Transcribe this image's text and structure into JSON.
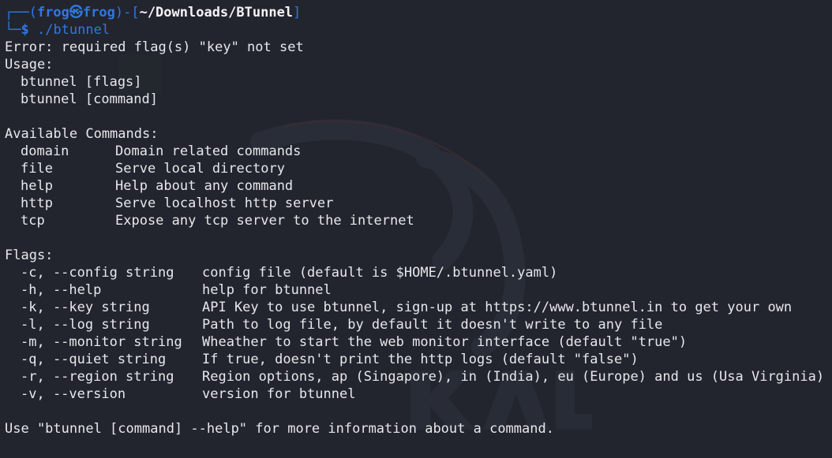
{
  "prompt": {
    "corner_top": "┌──(",
    "user": "frog",
    "at_symbol": "㉿",
    "host": "frog",
    "dir_open": ")-[",
    "dir": "~/Downloads/BTunnel",
    "dir_close": "]",
    "corner_bottom": "└─",
    "dollar": "$",
    "command": " ./btunnel"
  },
  "output": {
    "error": "Error: required flag(s) \"key\" not set",
    "usage_heading": "Usage:",
    "usage_lines": [
      "btunnel [flags]",
      "btunnel [command]"
    ],
    "commands_heading": "Available Commands:",
    "commands": [
      {
        "name": "domain",
        "desc": "Domain related commands"
      },
      {
        "name": "file",
        "desc": "Serve local directory"
      },
      {
        "name": "help",
        "desc": "Help about any command"
      },
      {
        "name": "http",
        "desc": "Serve localhost http server"
      },
      {
        "name": "tcp",
        "desc": "Expose any tcp server to the internet"
      }
    ],
    "flags_heading": "Flags:",
    "flags": [
      {
        "flag": "-c, --config string",
        "desc": "config file (default is $HOME/.btunnel.yaml)"
      },
      {
        "flag": "-h, --help",
        "desc": "help for btunnel"
      },
      {
        "flag": "-k, --key string",
        "desc": "API Key to use btunnel, sign-up at https://www.btunnel.in to get your own"
      },
      {
        "flag": "-l, --log string",
        "desc": "Path to log file, by default it doesn't write to any file"
      },
      {
        "flag": "-m, --monitor string",
        "desc": "Wheather to start the web monitor interface (default \"true\")"
      },
      {
        "flag": "-q, --quiet string",
        "desc": "If true, doesn't print the http logs (default \"false\")"
      },
      {
        "flag": "-r, --region string",
        "desc": "Region options, ap (Singapore), in (India), eu (Europe) and us (Usa Virginia)"
      },
      {
        "flag": "-v, --version",
        "desc": "version for btunnel"
      }
    ],
    "footer": "Use \"btunnel [command] --help\" for more information about a command."
  },
  "colors": {
    "background": "#22252d",
    "prompt_accent": "#2f77e6",
    "text": "#e6e8ec"
  },
  "background_watermark": "kali-dragon-logo"
}
